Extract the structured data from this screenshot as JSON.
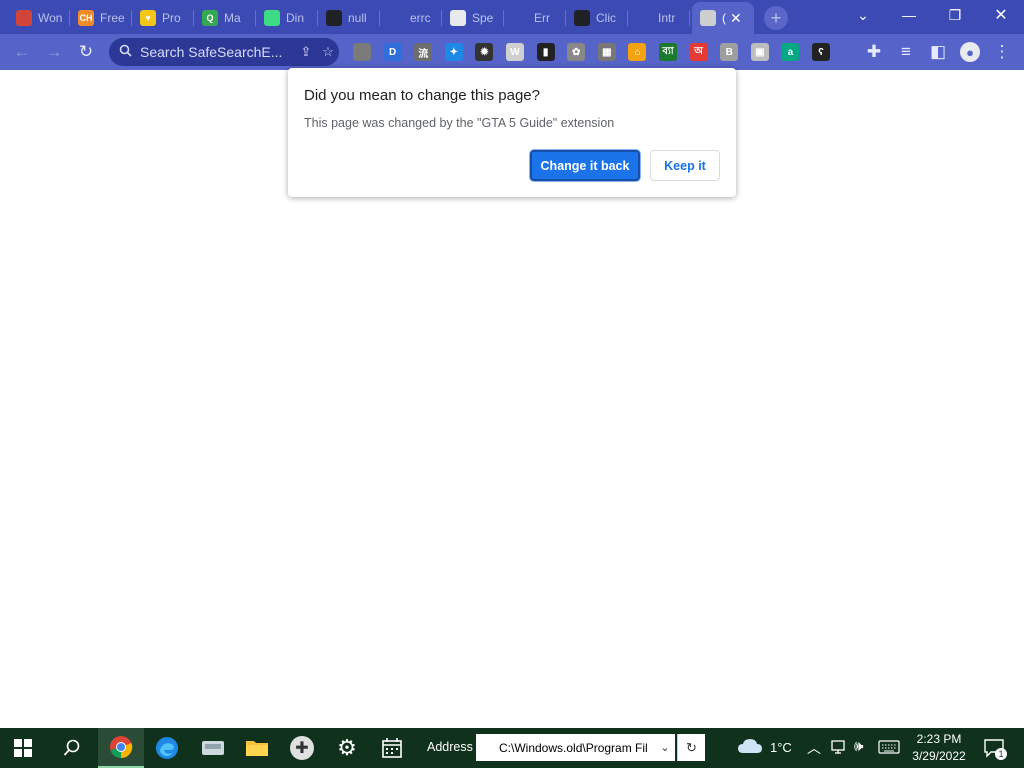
{
  "tabs": [
    {
      "label": "Won",
      "favicon_color": "#d0453a",
      "favicon_text": ""
    },
    {
      "label": "Free",
      "favicon_color": "#f28c28",
      "favicon_text": "CH"
    },
    {
      "label": "Pro",
      "favicon_color": "#f5c518",
      "favicon_text": "♥"
    },
    {
      "label": "Ma",
      "favicon_color": "#34a853",
      "favicon_text": "Q"
    },
    {
      "label": "Din",
      "favicon_color": "#3ddc84",
      "favicon_text": ""
    },
    {
      "label": "null",
      "favicon_color": "#202124",
      "favicon_text": ""
    },
    {
      "label": "errc",
      "favicon_color": "#3c4bb4",
      "favicon_text": ""
    },
    {
      "label": "Spe",
      "favicon_color": "#e8eaed",
      "favicon_text": ""
    },
    {
      "label": "Err",
      "favicon_color": "#3c4bb4",
      "favicon_text": ""
    },
    {
      "label": "Clic",
      "favicon_color": "#202124",
      "favicon_text": ""
    },
    {
      "label": "Intr",
      "favicon_color": "#3c4bb4",
      "favicon_text": ""
    },
    {
      "label": "(",
      "favicon_color": "#cfcfcf",
      "favicon_text": "",
      "active": true
    }
  ],
  "window_controls": {
    "tab_search": "⌄",
    "minimize": "—",
    "restore": "❐",
    "close": "✕"
  },
  "omnibox": {
    "text": "Search SafeSearchE..."
  },
  "extensions": [
    {
      "icon": "puzzle-grey-icon",
      "color": "#7a7a7a",
      "text": ""
    },
    {
      "icon": "d-icon",
      "color": "#2f6fdc",
      "text": "D"
    },
    {
      "icon": "kanji-icon",
      "color": "#6d6d6d",
      "text": "流"
    },
    {
      "icon": "shield-blue-icon",
      "color": "#1e88e5",
      "text": "✦"
    },
    {
      "icon": "bug-icon",
      "color": "#333333",
      "text": "✹"
    },
    {
      "icon": "w-icon",
      "color": "#d0d0d0",
      "text": "W"
    },
    {
      "icon": "bookmark-dark-icon",
      "color": "#222222",
      "text": "▮"
    },
    {
      "icon": "paw-icon",
      "color": "#888888",
      "text": "✿"
    },
    {
      "icon": "badge-icon",
      "color": "#777777",
      "text": "▦"
    },
    {
      "icon": "home-icon",
      "color": "#f2a30f",
      "text": "⌂"
    },
    {
      "icon": "bengali-icon",
      "color": "#1b7a2e",
      "text": "ব্যা"
    },
    {
      "icon": "bengali-red-icon",
      "color": "#e53935",
      "text": "অ"
    },
    {
      "icon": "b-icon",
      "color": "#9e9e9e",
      "text": "B"
    },
    {
      "icon": "pixel-icon",
      "color": "#bdbdbd",
      "text": "▣"
    },
    {
      "icon": "a-circle-icon",
      "color": "#00a884",
      "text": "a"
    },
    {
      "icon": "bear-icon",
      "color": "#222222",
      "text": "ʕ"
    }
  ],
  "dialog": {
    "title": "Did you mean to change this page?",
    "body": "This page was changed by the \"GTA 5 Guide\" extension",
    "primary_label": "Change it back",
    "secondary_label": "Keep it"
  },
  "taskbar": {
    "address_label": "Address",
    "address_value": "C:\\Windows.old\\Program Fil",
    "weather": "1°C",
    "time": "2:23 PM",
    "date": "3/29/2022",
    "notification_count": "1"
  }
}
